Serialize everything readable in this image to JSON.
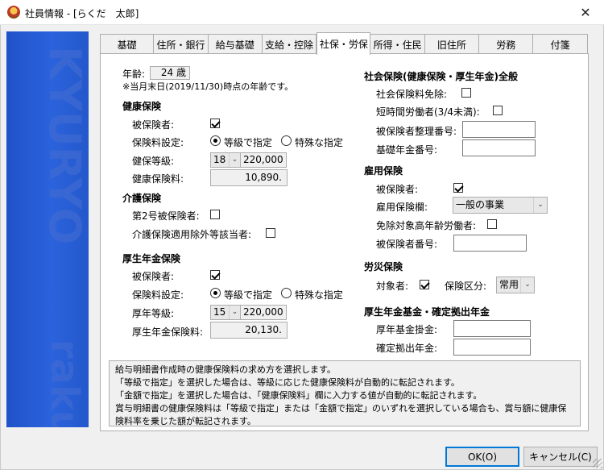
{
  "window": {
    "title": "社員情報 - [らくだ　太郎]",
    "close_glyph": "✕"
  },
  "banner": {
    "word_top": "KYURYO",
    "word_bottom": "rakuda"
  },
  "tabs": [
    "基礎",
    "住所・銀行",
    "給与基礎",
    "支給・控除",
    "社保・労保",
    "所得・住民",
    "旧住所",
    "労務",
    "付箋"
  ],
  "active_tab": "社保・労保",
  "age": {
    "label": "年齢:",
    "value": "24 歳",
    "note": "※当月末日(2019/11/30)時点の年齢です。"
  },
  "health": {
    "heading": "健康保険",
    "insured_label": "被保険者:",
    "insured": true,
    "premium_setting_label": "保険料設定:",
    "option_grade": "等級で指定",
    "option_special": "特殊な指定",
    "selected": "等級で指定",
    "grade_label": "健保等級:",
    "grade": "18",
    "grade_amount": "220,000",
    "premium_label": "健康保険料:",
    "premium": "10,890."
  },
  "nursing": {
    "heading": "介護保険",
    "type2_label": "第2号被保険者:",
    "type2": false,
    "exempt_label": "介護保険適用除外等該当者:",
    "exempt": false
  },
  "pension": {
    "heading": "厚生年金保険",
    "insured_label": "被保険者:",
    "insured": true,
    "premium_setting_label": "保険料設定:",
    "option_grade": "等級で指定",
    "option_special": "特殊な指定",
    "selected": "等級で指定",
    "grade_label": "厚年等級:",
    "grade": "15",
    "grade_amount": "220,000",
    "premium_label": "厚生年金保険料:",
    "premium": "20,130."
  },
  "social_general": {
    "heading": "社会保険(健康保険・厚生年金)全般",
    "exempt_label": "社会保険料免除:",
    "exempt": false,
    "short_time_label": "短時間労働者(3/4未満):",
    "short_time": false,
    "insured_number_label": "被保険者整理番号:",
    "insured_number": "",
    "pension_number_label": "基礎年金番号:",
    "pension_number": ""
  },
  "employment": {
    "heading": "雇用保険",
    "insured_label": "被保険者:",
    "insured": true,
    "column_label": "雇用保険欄:",
    "column_value": "一般の事業",
    "senior_label": "免除対象高年齢労働者:",
    "senior": false,
    "insured_number_label": "被保険者番号:",
    "insured_number": ""
  },
  "accident": {
    "heading": "労災保険",
    "target_label": "対象者:",
    "target": true,
    "category_label": "保険区分:",
    "category": "常用"
  },
  "fund": {
    "heading": "厚生年金基金・確定拠出年金",
    "fund_label": "厚年基金掛金:",
    "fund_value": "",
    "dc_label": "確定拠出年金:",
    "dc_value": ""
  },
  "info_lines": [
    "給与明細書作成時の健康保険料の求め方を選択します。",
    "「等級で指定」を選択した場合は、等級に応じた健康保険料が自動的に転記されます。",
    "「金額で指定」を選択した場合は、「健康保険料」欄に入力する値が自動的に転記されます。",
    "賞与明細書の健康保険料は「等級で指定」または「金額で指定」のいずれを選択している場合も、賞与額に健康保",
    "険料率を乗じた額が転記されます。"
  ],
  "buttons": {
    "ok": "OK(O)",
    "cancel": "キャンセル(C)"
  }
}
